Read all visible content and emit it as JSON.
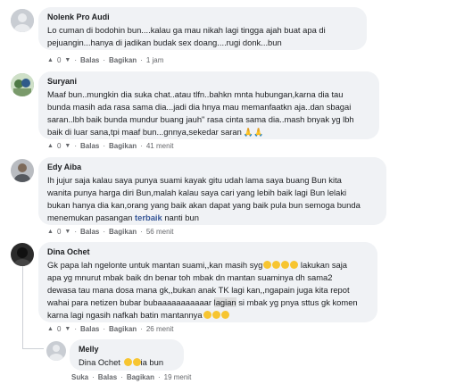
{
  "comments": [
    {
      "author": "Nolenk Pro Audi",
      "lines": [
        "Lo cuman di bodohin bun....kalau ga mau nikah lagi tingga ajah buat apa di",
        "pejuangin...hanya di jadikan budak sex doang....rugi donk...bun"
      ],
      "likes": "0",
      "reply": "Balas",
      "share": "Bagikan",
      "time": "1 jam"
    },
    {
      "author": "Suryani",
      "lines": [
        "Maaf bun..mungkin dia suka chat..atau tlfn..bahkn mnta hubungan,karna dia tau",
        "bunda masih ada rasa sama dia...jadi dia hnya mau memanfaatkn aja..dan sbagai",
        "saran..lbh baik bunda mundur buang jauh\" rasa cinta sama dia..mash bnyak yg lbh",
        "baik di luar sana,tpi maaf bun...gnnya,sekedar saran"
      ],
      "likes": "0",
      "reply": "Balas",
      "share": "Bagikan",
      "time": "41 menit"
    },
    {
      "author": "Edy Aiba",
      "lines": [
        "Ih jujur saja kalau saya punya suami kayak gitu udah lama saya buang Bun kita",
        "wanita punya harga diri Bun,malah kalau saya cari yang lebih baik lagi Bun lelaki",
        "bukan hanya dia kan,orang yang baik akan dapat yang baik pula bun semoga bunda"
      ],
      "last_line_pre": "menemukan pasangan ",
      "last_line_link": "terbaik",
      "last_line_post": " nanti bun",
      "likes": "0",
      "reply": "Balas",
      "share": "Bagikan",
      "time": "56 menit"
    },
    {
      "author": "Dina Ochet",
      "line1": "Gk papa lah ngelonte untuk mantan suami,,kan masih syg",
      "line1b": " lakukan saja",
      "lines": [
        "apa yg mnurut mbak baik dn benar toh mbak dn mantan suaminya dh sama2",
        "dewasa tau mana dosa mana gk,,bukan anak TK lagi kan,,ngapain juga kita repot"
      ],
      "line4_pre": "wahai para netizen bubar bubaaaaaaaaaaar ",
      "line4_hl": "lagian",
      "line4_post": " si mbak yg pnya sttus gk komen",
      "line5": "karna lagi ngasih nafkah batin mantannya",
      "likes": "0",
      "reply": "Balas",
      "share": "Bagikan",
      "time": "26 menit"
    },
    {
      "author": "Melly",
      "mention": "Dina Ochet",
      "text_post": "ia bun",
      "like_label": "Suka",
      "reply": "Balas",
      "share": "Bagikan",
      "time": "19 menit"
    }
  ]
}
